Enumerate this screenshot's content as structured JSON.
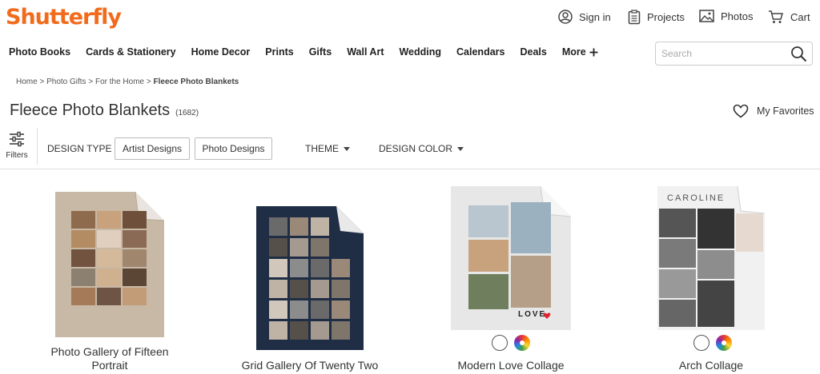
{
  "header": {
    "logo_text": "Shutterfly",
    "sign_in": "Sign in",
    "projects": "Projects",
    "photos": "Photos",
    "cart": "Cart"
  },
  "nav": {
    "items": [
      "Photo Books",
      "Cards & Stationery",
      "Home Decor",
      "Prints",
      "Gifts",
      "Wall Art",
      "Wedding",
      "Calendars",
      "Deals"
    ],
    "more_label": "More"
  },
  "search": {
    "placeholder": "Search"
  },
  "breadcrumb": {
    "home": "Home",
    "photo_gifts": "Photo Gifts",
    "for_the_home": "For the Home",
    "current": "Fleece Photo Blankets"
  },
  "page": {
    "title": "Fleece Photo Blankets",
    "count": "(1682)",
    "favorites_label": "My Favorites"
  },
  "filters": {
    "filters_label": "Filters",
    "design_type_label": "DESIGN TYPE",
    "chip_artist": "Artist Designs",
    "chip_photo": "Photo Designs",
    "theme_label": "THEME",
    "design_color_label": "DESIGN COLOR"
  },
  "products": [
    {
      "name_line1": "Photo Gallery of Fifteen",
      "name_line2": "Portrait"
    },
    {
      "name": "Grid Gallery Of Twenty Two"
    },
    {
      "name": "Modern Love Collage",
      "overlay_text": "LOVE"
    },
    {
      "name": "Arch Collage",
      "overlay_text": "CAROLINE"
    }
  ],
  "colors": {
    "brand": "#f26b1d",
    "blanket_beige": "#c8b8a6",
    "blanket_navy": "#1f2d45",
    "blanket_light": "#e7e7e7",
    "heart_red": "#e0242f"
  }
}
